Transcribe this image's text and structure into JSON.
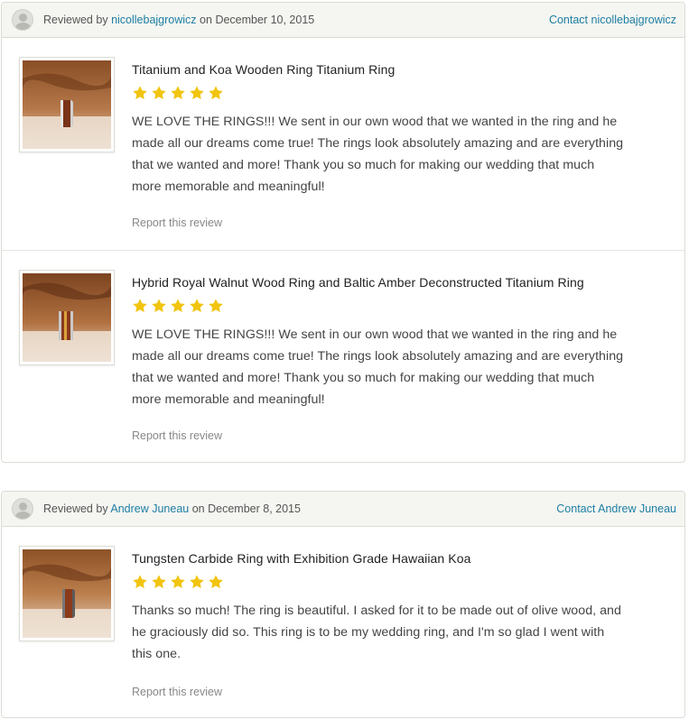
{
  "colors": {
    "link": "#1d7ea3",
    "star": "#f1c40f",
    "header_bg": "#f5f5f1",
    "border": "#dcdcd6"
  },
  "review_cards": [
    {
      "reviewed_by_prefix": "Reviewed by",
      "reviewer_name": "nicollebajgrowicz",
      "date_prefix": "on",
      "date": "December 10, 2015",
      "contact_label": "Contact nicollebajgrowicz",
      "avatar_icon": "default-user-avatar-icon",
      "reviews": [
        {
          "thumbnail": "titanium-koa-ring-photo",
          "title": "Titanium and Koa Wooden Ring Titanium Ring",
          "rating": 5,
          "text": "WE LOVE THE RINGS!!! We sent in our own wood that we wanted in the ring and he made all our dreams come true! The rings look absolutely amazing and are everything that we wanted and more! Thank you so much for making our wedding that much more memorable and meaningful!",
          "report_label": "Report this review"
        },
        {
          "thumbnail": "walnut-amber-ring-photo",
          "title": "Hybrid Royal Walnut Wood Ring and Baltic Amber Deconstructed Titanium Ring",
          "rating": 5,
          "text": "WE LOVE THE RINGS!!! We sent in our own wood that we wanted in the ring and he made all our dreams come true! The rings look absolutely amazing and are everything that we wanted and more! Thank you so much for making our wedding that much more memorable and meaningful!",
          "report_label": "Report this review"
        }
      ]
    },
    {
      "reviewed_by_prefix": "Reviewed by",
      "reviewer_name": "Andrew Juneau",
      "date_prefix": "on",
      "date": "December 8, 2015",
      "contact_label": "Contact Andrew Juneau",
      "avatar_icon": "default-user-avatar-icon",
      "reviews": [
        {
          "thumbnail": "tungsten-koa-ring-photo",
          "title": "Tungsten Carbide Ring with Exhibition Grade Hawaiian Koa",
          "rating": 5,
          "text": "Thanks so much! The ring is beautiful. I asked for it to be made out of olive wood, and he graciously did so. This ring is to be my wedding ring, and I'm so glad I went with this one.",
          "report_label": "Report this review"
        }
      ]
    }
  ]
}
